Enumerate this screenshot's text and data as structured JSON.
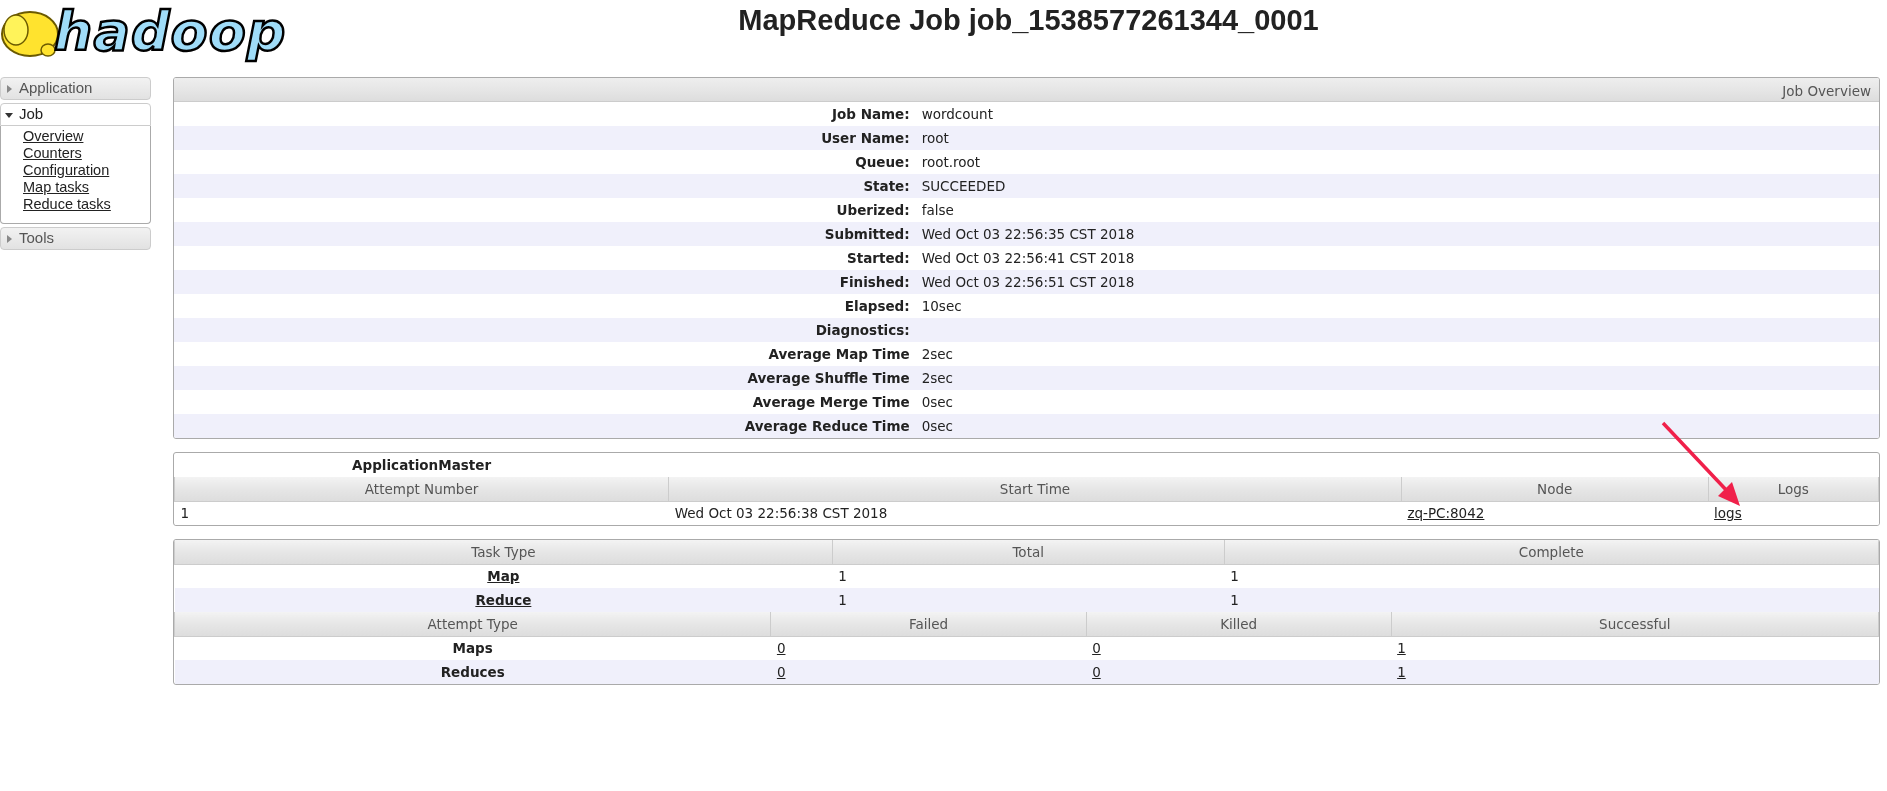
{
  "logo": {
    "text": "hadoop"
  },
  "title": "MapReduce Job job_1538577261344_0001",
  "sidebar": [
    {
      "label": "Application",
      "expanded": false
    },
    {
      "label": "Job",
      "expanded": true,
      "children": [
        "Overview",
        "Counters",
        "Configuration",
        "Map tasks",
        "Reduce tasks"
      ]
    },
    {
      "label": "Tools",
      "expanded": false
    }
  ],
  "overview": {
    "title": "Job Overview",
    "rows": [
      {
        "label": "Job Name:",
        "value": "wordcount"
      },
      {
        "label": "User Name:",
        "value": "root"
      },
      {
        "label": "Queue:",
        "value": "root.root"
      },
      {
        "label": "State:",
        "value": "SUCCEEDED"
      },
      {
        "label": "Uberized:",
        "value": "false"
      },
      {
        "label": "Submitted:",
        "value": "Wed Oct 03 22:56:35 CST 2018"
      },
      {
        "label": "Started:",
        "value": "Wed Oct 03 22:56:41 CST 2018"
      },
      {
        "label": "Finished:",
        "value": "Wed Oct 03 22:56:51 CST 2018"
      },
      {
        "label": "Elapsed:",
        "value": "10sec"
      },
      {
        "label": "Diagnostics:",
        "value": null
      },
      {
        "label": "Average Map Time",
        "value": "2sec"
      },
      {
        "label": "Average Shuffle Time",
        "value": "2sec"
      },
      {
        "label": "Average Merge Time",
        "value": "0sec"
      },
      {
        "label": "Average Reduce Time",
        "value": "0sec"
      }
    ]
  },
  "application_master": {
    "title": "ApplicationMaster",
    "columns": [
      "Attempt Number",
      "Start Time",
      "Node",
      "Logs"
    ],
    "rows": [
      {
        "attempt": "1",
        "start_time": "Wed Oct 03 22:56:38 CST 2018",
        "node": "zq-PC:8042",
        "logs": "logs"
      }
    ]
  },
  "tasks": {
    "columns": [
      "Task Type",
      "Total",
      "Complete"
    ],
    "rows": [
      {
        "type": "Map",
        "total": "1",
        "complete": "1"
      },
      {
        "type": "Reduce",
        "total": "1",
        "complete": "1"
      }
    ]
  },
  "attempts": {
    "columns": [
      "Attempt Type",
      "Failed",
      "Killed",
      "Successful"
    ],
    "rows": [
      {
        "type": "Maps",
        "failed": "0",
        "killed": "0",
        "successful": "1"
      },
      {
        "type": "Reduces",
        "failed": "0",
        "killed": "0",
        "successful": "1"
      }
    ]
  }
}
